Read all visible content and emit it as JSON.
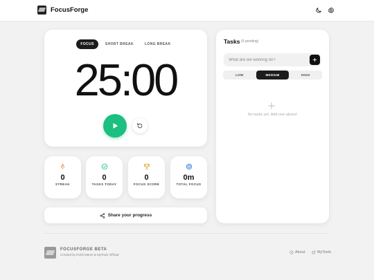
{
  "header": {
    "brand": "FocusForge",
    "theme_icon": "moon-icon",
    "settings_icon": "gear-icon"
  },
  "timer": {
    "tabs": [
      {
        "label": "FOCUS",
        "active": true
      },
      {
        "label": "SHORT BREAK",
        "active": false
      },
      {
        "label": "LONG BREAK",
        "active": false
      }
    ],
    "time": "25:00",
    "play_icon": "play-icon",
    "reset_icon": "reset-icon"
  },
  "stats": [
    {
      "icon": "flame-icon",
      "value": "0",
      "label": "STREAK"
    },
    {
      "icon": "check-circle-icon",
      "value": "0",
      "label": "TASKS TODAY"
    },
    {
      "icon": "trophy-icon",
      "value": "0",
      "label": "FOCUS SCORE"
    },
    {
      "icon": "target-icon",
      "value": "0m",
      "label": "TOTAL FOCUS"
    }
  ],
  "share": {
    "label": "Share your progress",
    "icon": "share-icon"
  },
  "tasks": {
    "title": "Tasks",
    "pending": "(0 pending)",
    "input_placeholder": "What are we working on?",
    "add_icon": "plus-icon",
    "priorities": [
      {
        "label": "LOW",
        "active": false
      },
      {
        "label": "MEDIUM",
        "active": true
      },
      {
        "label": "HIGH",
        "active": false
      }
    ],
    "empty_text": "No tasks yet. Add one above!"
  },
  "footer": {
    "title": "FOCUSFORGE BETA",
    "subtitle": "Created by Rohit Mantri & MyTools Official",
    "about": "About",
    "mytools": "MyTools"
  },
  "colors": {
    "accent": "#1cbf7f",
    "dark": "#1c1c1c",
    "streak": "#f07a2a",
    "tasks": "#1cbf7f",
    "score": "#d9a11b",
    "focus": "#3a7bd5"
  }
}
